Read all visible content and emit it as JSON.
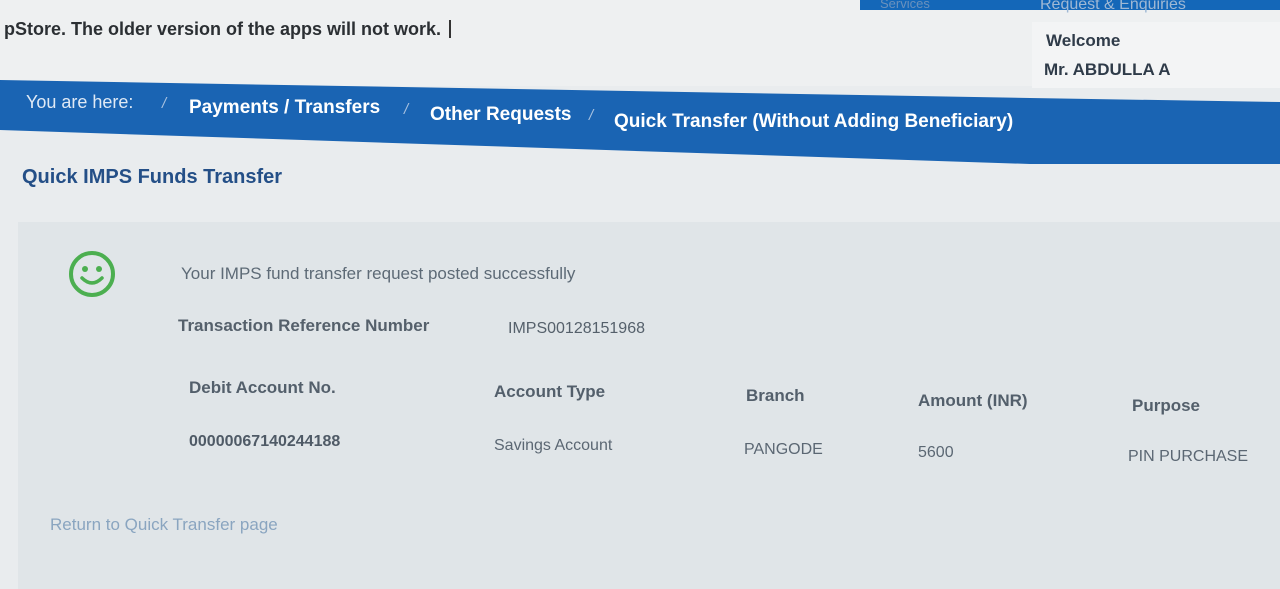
{
  "header": {
    "services_label": "Services",
    "request_link": "Request & Enquiries",
    "marquee_text": "pStore. The older version of the apps will not work.",
    "welcome_label": "Welcome",
    "user_name": "Mr. ABDULLA A"
  },
  "breadcrumb": {
    "lead": "You are here:",
    "separator": "/",
    "items": [
      "Payments / Transfers",
      "Other Requests",
      "Quick Transfer (Without Adding Beneficiary)"
    ]
  },
  "page": {
    "title": "Quick IMPS Funds Transfer",
    "success_message": "Your IMPS fund transfer request posted successfully",
    "ref_label": "Transaction Reference Number",
    "ref_value": "IMPS00128151968",
    "return_link": "Return to Quick Transfer page"
  },
  "table": {
    "headers": [
      "Debit Account No.",
      "Account Type",
      "Branch",
      "Amount (INR)",
      "Purpose"
    ],
    "row": [
      "00000067140244188",
      "Savings Account",
      "PANGODE",
      "5600",
      "PIN PURCHASE"
    ]
  },
  "colors": {
    "brand_blue": "#1a64b3",
    "success_green": "#4caf50"
  },
  "icons": {
    "success": "smiley-face-icon"
  }
}
